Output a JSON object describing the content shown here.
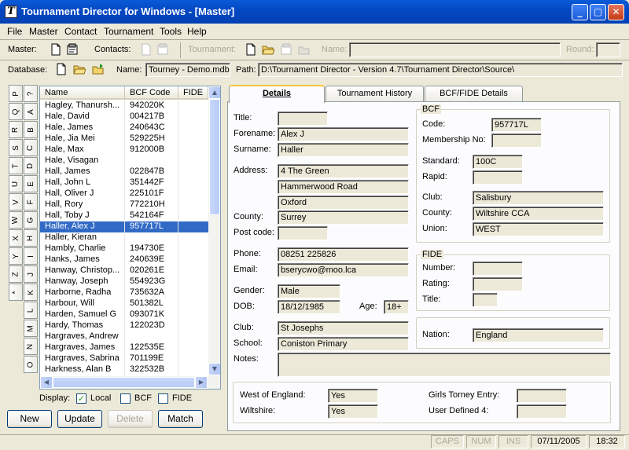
{
  "window": {
    "title": "Tournament Director for Windows - [Master]"
  },
  "menu": [
    "File",
    "Master",
    "Contact",
    "Tournament",
    "Tools",
    "Help"
  ],
  "toolbar": {
    "master_label": "Master:",
    "contacts_label": "Contacts:",
    "tournament_label": "Tournament:",
    "name_label": "Name:",
    "round_label": "Round:",
    "database_label": "Database:",
    "db_name_label": "Name:",
    "db_name_value": "Tourney - Demo.mdb",
    "path_label": "Path:",
    "path_value": "D:\\Tournament Director - Version 4.7\\Tournament Director\\Source\\"
  },
  "alpha_tabs_col1": [
    "P",
    "Q",
    "R",
    "S",
    "T",
    "U",
    "V",
    "W",
    "X",
    "Y",
    "Z",
    "*"
  ],
  "alpha_tabs_col2": [
    "?",
    "A",
    "B",
    "C",
    "D",
    "E",
    "F",
    "G",
    "H",
    "I",
    "J",
    "K",
    "L",
    "M",
    "N",
    "O"
  ],
  "grid": {
    "columns": [
      "Name",
      "BCF Code",
      "FIDE"
    ],
    "rows": [
      {
        "name": "Hagley, Thanursh...",
        "code": "942020K",
        "sel": false
      },
      {
        "name": "Hale, David",
        "code": "004217B",
        "sel": false
      },
      {
        "name": "Hale, James",
        "code": "240643C",
        "sel": false
      },
      {
        "name": "Hale, Jia Mei",
        "code": "529225H",
        "sel": false
      },
      {
        "name": "Hale, Max",
        "code": "912000B",
        "sel": false
      },
      {
        "name": "Hale, Visagan",
        "code": "",
        "sel": false
      },
      {
        "name": "Hall, James",
        "code": "022847B",
        "sel": false
      },
      {
        "name": "Hall, John L",
        "code": "351442F",
        "sel": false
      },
      {
        "name": "Hall, Oliver J",
        "code": "225101F",
        "sel": false
      },
      {
        "name": "Hall, Rory",
        "code": "772210H",
        "sel": false
      },
      {
        "name": "Hall, Toby J",
        "code": "542164F",
        "sel": false
      },
      {
        "name": "Haller, Alex J",
        "code": "957717L",
        "sel": true
      },
      {
        "name": "Haller, Kieran",
        "code": "",
        "sel": false
      },
      {
        "name": "Hambly, Charlie",
        "code": "194730E",
        "sel": false
      },
      {
        "name": "Hanks, James",
        "code": "240639E",
        "sel": false
      },
      {
        "name": "Hanway, Christop...",
        "code": "020261E",
        "sel": false
      },
      {
        "name": "Hanway, Joseph",
        "code": "554923G",
        "sel": false
      },
      {
        "name": "Harborne, Radha",
        "code": "735632A",
        "sel": false
      },
      {
        "name": "Harbour, Will",
        "code": "501382L",
        "sel": false
      },
      {
        "name": "Harden, Samuel G",
        "code": "093071K",
        "sel": false
      },
      {
        "name": "Hardy, Thomas",
        "code": "122023D",
        "sel": false
      },
      {
        "name": "Hargraves, Andrew",
        "code": "",
        "sel": false
      },
      {
        "name": "Hargraves, James",
        "code": "122535E",
        "sel": false
      },
      {
        "name": "Hargraves, Sabrina",
        "code": "701199E",
        "sel": false
      },
      {
        "name": "Harkness, Alan B",
        "code": "322532B",
        "sel": false
      }
    ]
  },
  "display": {
    "label": "Display:",
    "local": "Local",
    "bcf": "BCF",
    "fide": "FIDE",
    "local_checked": true,
    "bcf_checked": false,
    "fide_checked": false
  },
  "buttons": {
    "new": "New",
    "update": "Update",
    "delete": "Delete",
    "match": "Match"
  },
  "tabs": {
    "details": "Details",
    "history": "Tournament History",
    "bcf_fide": "BCF/FIDE Details"
  },
  "details": {
    "title_label": "Title:",
    "title": "",
    "forename_label": "Forename:",
    "forename": "Alex J",
    "surname_label": "Surname:",
    "surname": "Haller",
    "address_label": "Address:",
    "address1": "4 The Green",
    "address2": "Hammerwood Road",
    "address3": "Oxford",
    "county_label": "County:",
    "county": "Surrey",
    "postcode_label": "Post code:",
    "postcode": "",
    "phone_label": "Phone:",
    "phone": "08251 225826",
    "email_label": "Email:",
    "email": "bserycwo@moo.lca",
    "gender_label": "Gender:",
    "gender": "Male",
    "dob_label": "DOB:",
    "dob": "18/12/1985",
    "age_label": "Age:",
    "age": "18+",
    "club_label": "Club:",
    "club": "St Josephs",
    "school_label": "School:",
    "school": "Coniston Primary",
    "notes_label": "Notes:",
    "notes": ""
  },
  "bcf": {
    "group": "BCF",
    "code_label": "Code:",
    "code": "957717L",
    "membership_label": "Membership No:",
    "membership": "",
    "standard_label": "Standard:",
    "standard": "100C",
    "rapid_label": "Rapid:",
    "rapid": "",
    "club_label": "Club:",
    "club": "Salisbury",
    "county_label": "County:",
    "county": "Wiltshire CCA",
    "union_label": "Union:",
    "union": "WEST"
  },
  "fide": {
    "group": "FIDE",
    "number_label": "Number:",
    "number": "",
    "rating_label": "Rating:",
    "rating": "",
    "title_label": "Title:",
    "title": ""
  },
  "nation": {
    "label": "Nation:",
    "value": "England"
  },
  "extra": {
    "woe_label": "West of England:",
    "woe": "Yes",
    "wilts_label": "Wiltshire:",
    "wilts": "Yes",
    "girls_label": "Girls Torney Entry:",
    "girls": "",
    "ud4_label": "User Defined 4:",
    "ud4": ""
  },
  "statusbar": {
    "caps": "CAPS",
    "num": "NUM",
    "ins": "INS",
    "date": "07/11/2005",
    "time": "18:32"
  }
}
